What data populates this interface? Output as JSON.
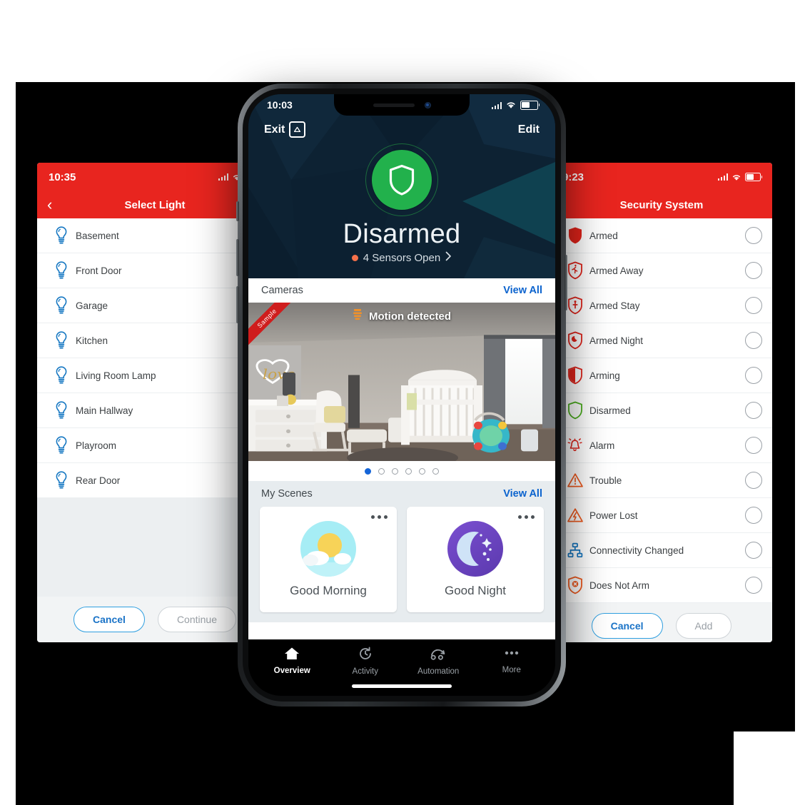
{
  "left_phone": {
    "status": {
      "time": "10:35",
      "signal_icon": "signal-bars-icon",
      "wifi_icon": "wifi-icon",
      "battery_icon": "battery-icon"
    },
    "nav": {
      "back_icon": "chevron-left-icon",
      "title": "Select Light"
    },
    "rows": [
      {
        "icon": "lightbulb-icon",
        "label": "Basement",
        "control": "checkbox"
      },
      {
        "icon": "lightbulb-icon",
        "label": "Front Door",
        "control": "checkbox"
      },
      {
        "icon": "lightbulb-icon",
        "label": "Garage",
        "control": "checkbox"
      },
      {
        "icon": "lightbulb-icon",
        "label": "Kitchen",
        "control": "checkbox"
      },
      {
        "icon": "lightbulb-icon",
        "label": "Living Room Lamp",
        "control": "checkbox"
      },
      {
        "icon": "lightbulb-icon",
        "label": "Main Hallway",
        "control": "checkbox"
      },
      {
        "icon": "lightbulb-icon",
        "label": "Playroom",
        "control": "checkbox"
      },
      {
        "icon": "lightbulb-icon",
        "label": "Rear Door",
        "control": "checkbox"
      }
    ],
    "footer": {
      "cancel": "Cancel",
      "primary": "Continue"
    }
  },
  "center_phone": {
    "status": {
      "time": "10:03",
      "signal_icon": "signal-bars-icon",
      "wifi_icon": "wifi-icon",
      "battery_icon": "battery-icon"
    },
    "hero": {
      "exit_label": "Exit",
      "exit_icon": "exit-box-icon",
      "edit_label": "Edit",
      "shield_icon": "shield-icon",
      "state": "Disarmed",
      "sensors_text": "4 Sensors Open",
      "sensors_chevron": "chevron-right-icon",
      "status_color": "#22b14c",
      "sensor_dot_color": "#f5704a"
    },
    "cameras": {
      "title": "Cameras",
      "view_all": "View All",
      "overlay_icon": "motion-sensor-icon",
      "overlay_text": "Motion detected",
      "ribbon": "Sample",
      "page_dots": 6,
      "active_dot": 1
    },
    "scenes": {
      "title": "My Scenes",
      "view_all": "View All",
      "cards": [
        {
          "icon": "sun-cloud-icon",
          "label": "Good Morning",
          "menu_icon": "more-dots-icon"
        },
        {
          "icon": "moon-stars-icon",
          "label": "Good Night",
          "menu_icon": "more-dots-icon"
        }
      ]
    },
    "tabs": [
      {
        "icon": "home-icon",
        "label": "Overview",
        "active": true
      },
      {
        "icon": "history-clock-icon",
        "label": "Activity",
        "active": false
      },
      {
        "icon": "automation-icon",
        "label": "Automation",
        "active": false
      },
      {
        "icon": "more-dots-icon",
        "label": "More",
        "active": false
      }
    ]
  },
  "right_phone": {
    "status": {
      "time": "9:23",
      "signal_icon": "signal-bars-icon",
      "wifi_icon": "wifi-icon",
      "battery_icon": "battery-icon"
    },
    "nav": {
      "title": "Security System"
    },
    "rows": [
      {
        "icon": "shield-filled-icon",
        "label": "Armed",
        "control": "radio"
      },
      {
        "icon": "shield-running-person-icon",
        "label": "Armed Away",
        "control": "radio"
      },
      {
        "icon": "shield-person-icon",
        "label": "Armed Stay",
        "control": "radio"
      },
      {
        "icon": "shield-moon-icon",
        "label": "Armed Night",
        "control": "radio"
      },
      {
        "icon": "shield-half-icon",
        "label": "Arming",
        "control": "radio"
      },
      {
        "icon": "shield-outline-green-icon",
        "label": "Disarmed",
        "control": "radio"
      },
      {
        "icon": "alarm-bell-icon",
        "label": "Alarm",
        "control": "radio"
      },
      {
        "icon": "warning-triangle-icon",
        "label": "Trouble",
        "control": "radio"
      },
      {
        "icon": "power-lost-icon",
        "label": "Power Lost",
        "control": "radio"
      },
      {
        "icon": "network-nodes-icon",
        "label": "Connectivity Changed",
        "control": "radio"
      },
      {
        "icon": "shield-x-icon",
        "label": "Does Not Arm",
        "control": "radio"
      }
    ],
    "footer": {
      "cancel": "Cancel",
      "primary": "Add"
    }
  }
}
